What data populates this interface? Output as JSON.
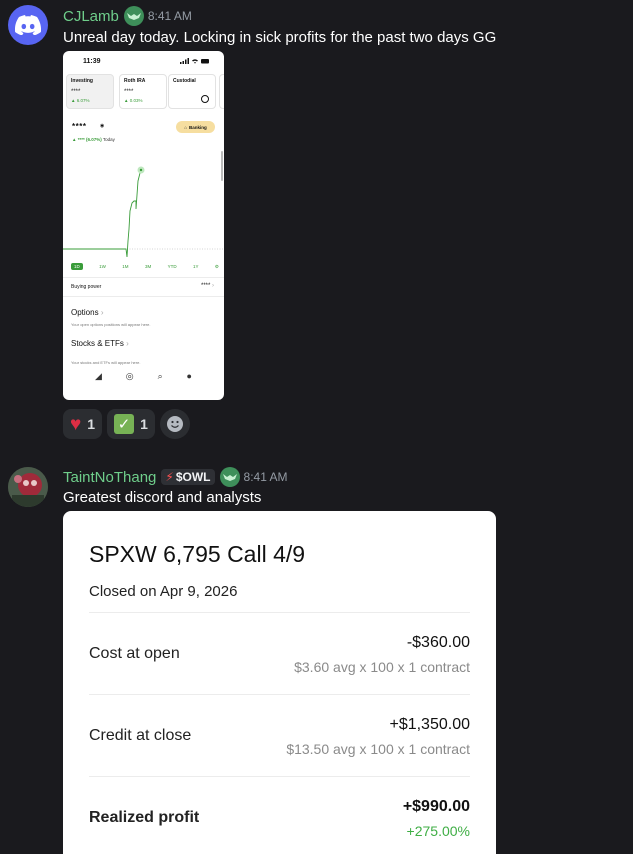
{
  "messages": [
    {
      "username": "CJLamb",
      "timestamp": "8:41 AM",
      "text": "Unreal day today. Locking in sick profits for the past two days GG",
      "attachment": {
        "status_time": "11:39",
        "accounts": [
          {
            "name": "Investing",
            "value": "****",
            "change": "▲ 6.07%"
          },
          {
            "name": "Roth IRA",
            "value": "****",
            "change": "▲ 0.03%"
          },
          {
            "name": "Custodial",
            "value": "",
            "change": ""
          }
        ],
        "balance": "****",
        "banking_label": "Banking",
        "today_change": "▲ **** (6.07%)",
        "today_label": "Today",
        "ranges": [
          "1D",
          "1W",
          "1M",
          "3M",
          "YTD",
          "1Y"
        ],
        "buying_power_label": "Buying power",
        "buying_power_value": "****",
        "sections": [
          {
            "title": "Options",
            "subtitle": "Your open options positions will appear here."
          },
          {
            "title": "Stocks & ETFs",
            "subtitle": "Your stocks and ETFs will appear here."
          }
        ],
        "chart_color": "#3a9c3a"
      },
      "reactions": [
        {
          "emoji": "heart",
          "count": "1"
        },
        {
          "emoji": "check-mark",
          "count": "1"
        }
      ]
    },
    {
      "username": "TaintNoThang",
      "tag": "$OWL",
      "timestamp": "8:41 AM",
      "text": "Greatest discord and analysts",
      "card": {
        "title": "SPXW 6,795 Call 4/9",
        "closed": "Closed on Apr 9, 2026",
        "rows": [
          {
            "label": "Cost at open",
            "main": "-$360.00",
            "sub": "$3.60 avg x 100 x 1 contract"
          },
          {
            "label": "Credit at close",
            "main": "+$1,350.00",
            "sub": "$13.50 avg x 100 x 1 contract"
          },
          {
            "label": "Realized profit",
            "main": "+$990.00",
            "sub": "+275.00%"
          }
        ]
      }
    }
  ],
  "colors": {
    "background": "#1a1a1e",
    "username": "#6fce8b",
    "discord_brand": "#5865f2",
    "profit_green": "#3fae45"
  }
}
